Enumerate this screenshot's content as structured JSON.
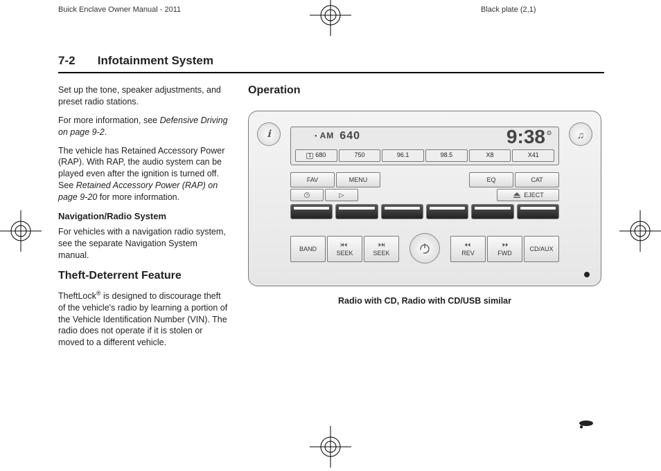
{
  "header": {
    "left": "Buick Enclave Owner Manual - 2011",
    "right": "Black plate (2,1)"
  },
  "page": {
    "number": "7-2",
    "title": "Infotainment System"
  },
  "left_col": {
    "bullet": "Set up the tone, speaker adjustments, and preset radio stations.",
    "p1a": "For more information, see ",
    "p1b": "Defensive Driving on page 9-2",
    "p1c": ".",
    "p2a": "The vehicle has Retained Accessory Power (RAP). With RAP, the audio system can be played even after the ignition is turned off. See ",
    "p2b": "Retained Accessory Power (RAP) on page 9-20",
    "p2c": " for more information.",
    "h_nav": "Navigation/Radio System",
    "p3": "For vehicles with a navigation radio system, see the separate Navigation System manual.",
    "h_theft": "Theft-Deterrent Feature",
    "p4a": "TheftLock",
    "p4sup": "®",
    "p4b": " is designed to discourage theft of the vehicle's radio by learning a portion of the Vehicle Identification Number (VIN). The radio does not operate if it is stolen or moved to a different vehicle."
  },
  "right_col": {
    "title": "Operation",
    "caption": "Radio with CD, Radio with CD/USB similar"
  },
  "radio": {
    "band": "AM",
    "freq": "640",
    "clock": "9:38",
    "presets": [
      "680",
      "750",
      "96.1",
      "98.5",
      "X8",
      "X41"
    ],
    "row1": [
      "FAV",
      "MENU",
      "",
      "",
      "EQ",
      "CAT"
    ],
    "row1b_clock_icon": "clock-icon",
    "row1b_play": "▷",
    "row1b_eject": "EJECT",
    "row2": {
      "band": "BAND",
      "seek_prev": "SEEK",
      "seek_next": "SEEK",
      "rev": "REV",
      "fwd": "FWD",
      "cdaux": "CD/AUX"
    }
  }
}
